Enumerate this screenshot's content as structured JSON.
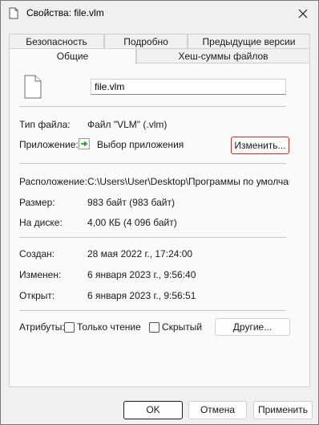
{
  "window": {
    "title": "Свойства: file.vlm",
    "close_icon": "close-icon"
  },
  "tabs": {
    "back_row": [
      "Безопасность",
      "Подробно",
      "Предыдущие версии"
    ],
    "front_row": [
      "Общие",
      "Хеш-суммы файлов"
    ],
    "active": "Общие"
  },
  "general": {
    "filename": "file.vlm",
    "file_type_label": "Тип файла:",
    "file_type_value": "Файл \"VLM\" (.vlm)",
    "app_label": "Приложение:",
    "app_value": "Выбор приложения",
    "change_button": "Изменить...",
    "location_label": "Расположение:",
    "location_value": "C:\\Users\\User\\Desktop\\Программы по умолчанию",
    "size_label": "Размер:",
    "size_value": "983 байт (983 байт)",
    "disk_label": "На диске:",
    "disk_value": "4,00 КБ (4 096 байт)",
    "created_label": "Создан:",
    "created_value": "28 мая 2022 г., 17:24:00",
    "modified_label": "Изменен:",
    "modified_value": "6 января 2023 г., 9:56:40",
    "accessed_label": "Открыт:",
    "accessed_value": "6 января 2023 г., 9:56:51",
    "attributes_label": "Атрибуты:",
    "readonly_label": "Только чтение",
    "readonly_checked": false,
    "hidden_label": "Скрытый",
    "hidden_checked": false,
    "other_button": "Другие..."
  },
  "footer": {
    "ok": "OK",
    "cancel": "Отмена",
    "apply": "Применить"
  },
  "colors": {
    "focus_border": "#c42b1c",
    "app_icon_green": "#2e9e3a"
  }
}
